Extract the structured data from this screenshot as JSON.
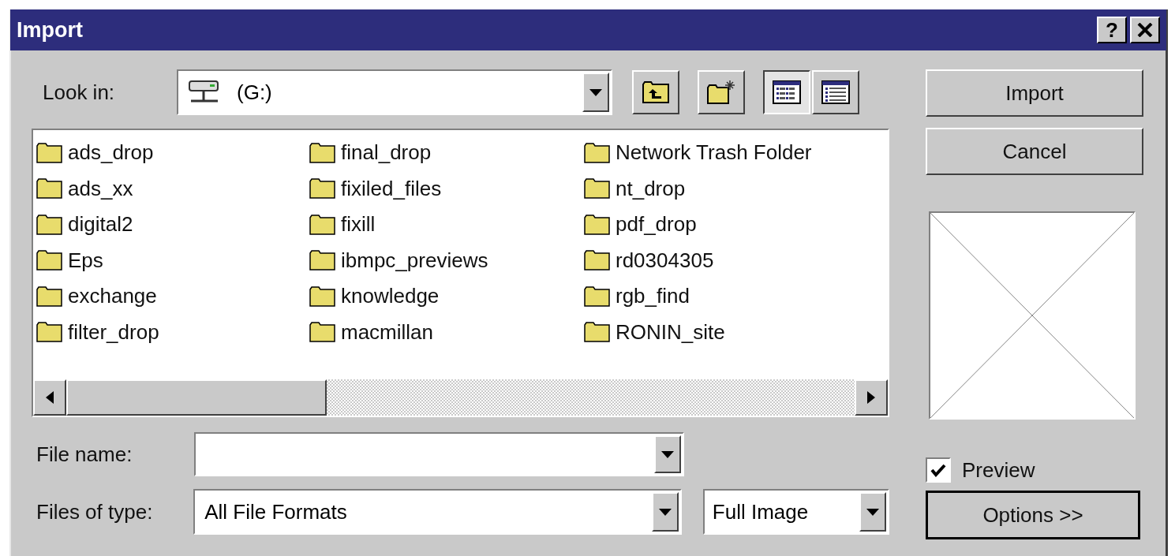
{
  "window": {
    "title": "Import",
    "help_button": "?"
  },
  "look_in": {
    "label": "Look in:",
    "value": "(G:)"
  },
  "view_buttons": [
    {
      "kind": "list",
      "selected": true
    },
    {
      "kind": "details",
      "selected": false
    }
  ],
  "files": [
    {
      "name": "ads_drop"
    },
    {
      "name": "ads_xx"
    },
    {
      "name": "digital2"
    },
    {
      "name": "Eps"
    },
    {
      "name": "exchange"
    },
    {
      "name": "filter_drop"
    },
    {
      "name": "final_drop"
    },
    {
      "name": "fixiled_files"
    },
    {
      "name": "fixill"
    },
    {
      "name": "ibmpc_previews"
    },
    {
      "name": "knowledge"
    },
    {
      "name": "macmillan"
    },
    {
      "name": "Network Trash Folder"
    },
    {
      "name": "nt_drop"
    },
    {
      "name": "pdf_drop"
    },
    {
      "name": "rd0304305"
    },
    {
      "name": "rgb_find"
    },
    {
      "name": "RONIN_site"
    }
  ],
  "file_name": {
    "label": "File name:"
  },
  "files_of_type": {
    "label": "Files of type:",
    "value": "All File Formats"
  },
  "image_mode": {
    "value": "Full Image"
  },
  "buttons": [
    {
      "label": "Import"
    },
    {
      "label": "Cancel"
    }
  ],
  "preview": {
    "label": "Preview",
    "checked": true
  },
  "options_button": {
    "label": "Options >>"
  }
}
